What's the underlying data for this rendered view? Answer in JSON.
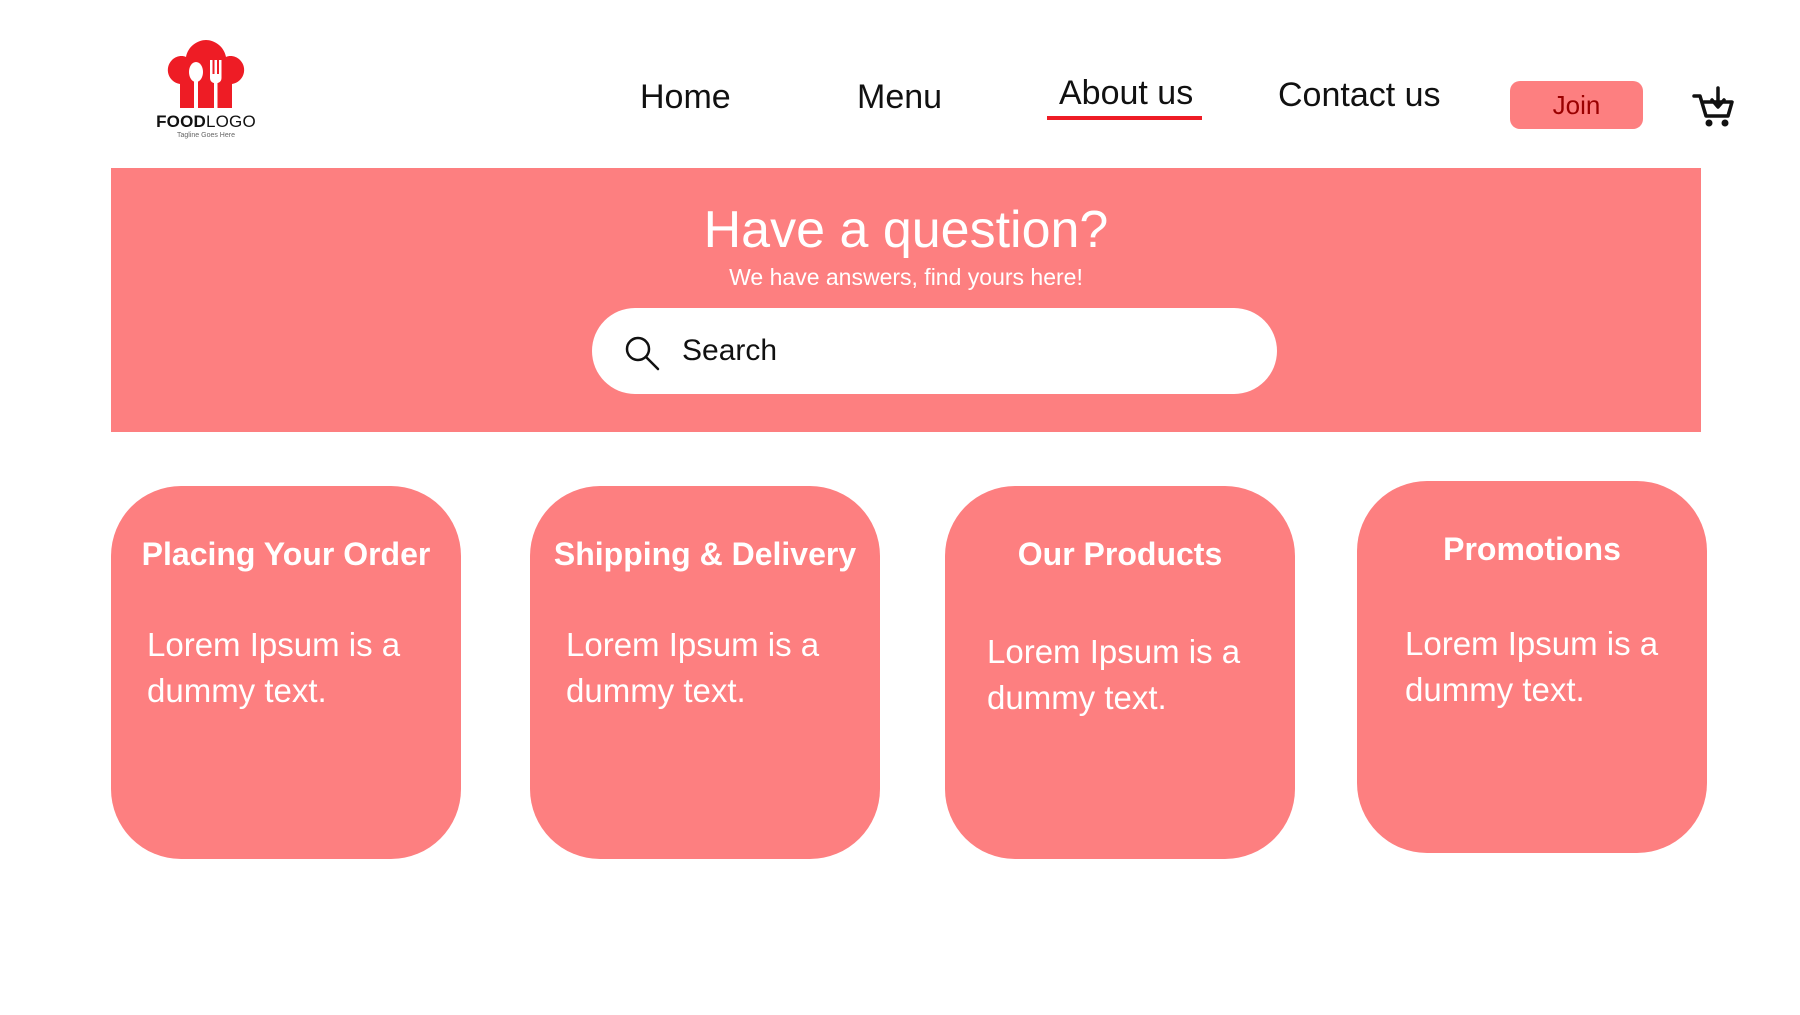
{
  "brand": {
    "name_bold": "FOOD",
    "name_light": "LOGO",
    "tagline": "Tagline Goes Here",
    "logo_icon": "chef-hat-spoon-fork-icon",
    "logo_color": "#ee1c25"
  },
  "nav": {
    "items": [
      {
        "label": "Home"
      },
      {
        "label": "Menu"
      },
      {
        "label": "About us",
        "active": true
      },
      {
        "label": "Contact us"
      }
    ],
    "join_label": "Join",
    "cart_icon": "cart-icon",
    "active_underline_color": "#ee1c25"
  },
  "hero": {
    "title": "Have a question?",
    "subtitle": "We have answers, find yours here!",
    "search_placeholder": "Search",
    "search_icon": "search-icon",
    "background": "#fd7f80"
  },
  "cards": [
    {
      "title": "Placing Your Order",
      "body": "Lorem Ipsum is a dummy text."
    },
    {
      "title": "Shipping & Delivery",
      "body": "Lorem Ipsum is a dummy text."
    },
    {
      "title": "Our Products",
      "body": "Lorem Ipsum is a dummy text."
    },
    {
      "title": "Promotions",
      "body": "Lorem Ipsum is a dummy text."
    }
  ],
  "colors": {
    "accent": "#fd7f80",
    "brand_red": "#ee1c25",
    "text": "#111111",
    "join_text": "#9a0000"
  }
}
